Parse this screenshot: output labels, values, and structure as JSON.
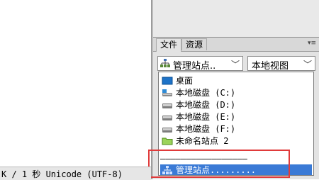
{
  "status": {
    "text": "K / 1 秒 Unicode (UTF-8)"
  },
  "panel": {
    "tabs": [
      {
        "label": "文件"
      },
      {
        "label": "资源"
      }
    ],
    "menu_glyph": "▾≡",
    "site_select": {
      "value": "管理站点..",
      "icon": "site-network-icon"
    },
    "view_select": {
      "value": "本地视图"
    }
  },
  "dropdown": {
    "items": [
      {
        "label": "桌面",
        "icon": "desktop-icon"
      },
      {
        "label": "本地磁盘 (C:)",
        "icon": "system-drive-icon"
      },
      {
        "label": "本地磁盘 (D:)",
        "icon": "drive-icon"
      },
      {
        "label": "本地磁盘 (E:)",
        "icon": "drive-icon"
      },
      {
        "label": "本地磁盘 (F:)",
        "icon": "drive-icon"
      },
      {
        "label": "未命名站点 2",
        "icon": "folder-icon"
      }
    ],
    "separator": "—————————————————",
    "selected_item": {
      "label": "管理站点.........",
      "icon": "site-network-icon"
    }
  },
  "colors": {
    "highlight": "#3a7ad6",
    "annotation": "#e03a3a"
  }
}
